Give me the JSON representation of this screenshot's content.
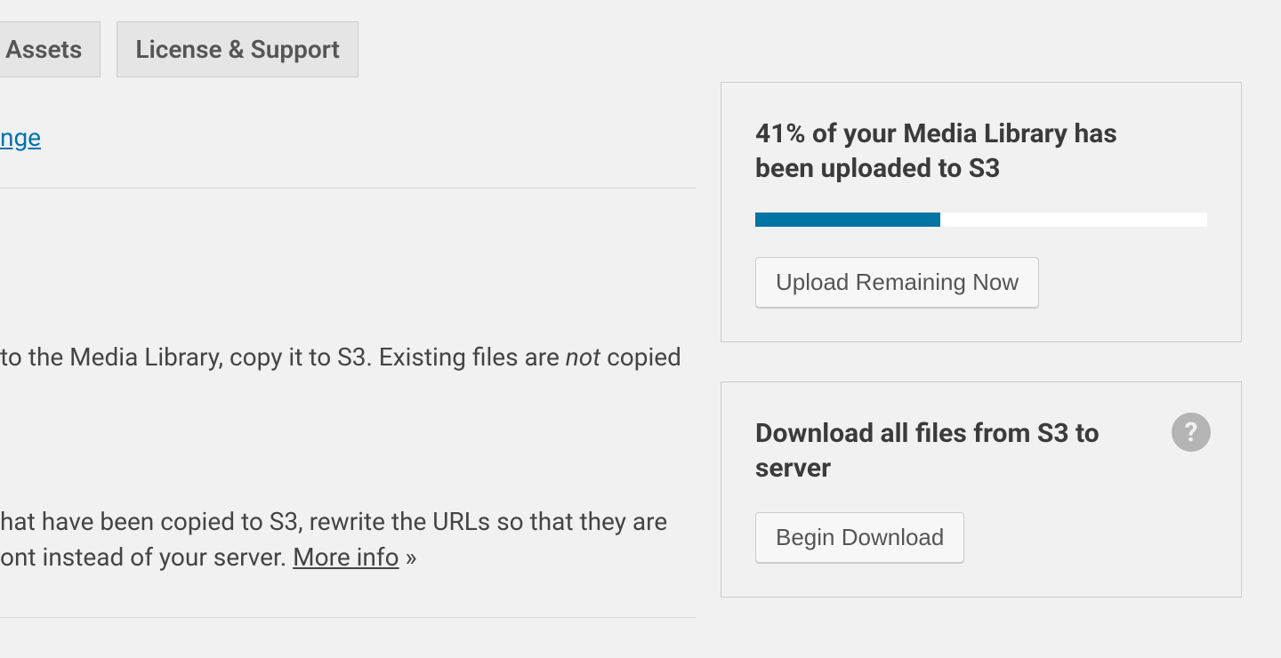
{
  "tabs": {
    "assets": "Assets",
    "license": "License & Support"
  },
  "main": {
    "link_fragment": "nge",
    "copy_text_prefix": "to the Media Library, copy it to S3. Existing files are ",
    "copy_text_em": "not",
    "copy_text_suffix": " copied",
    "rewrite_line1": "hat have been copied to S3, rewrite the URLs so that they are",
    "rewrite_line2_prefix": "ont instead of your server. ",
    "rewrite_more": "More info",
    "rewrite_raquo": " »"
  },
  "upload_card": {
    "title": "41% of your Media Library has been uploaded to S3",
    "progress_percent": 41,
    "button": "Upload Remaining Now"
  },
  "download_card": {
    "title": "Download all files from S3 to server",
    "help_glyph": "?",
    "button": "Begin Download"
  }
}
